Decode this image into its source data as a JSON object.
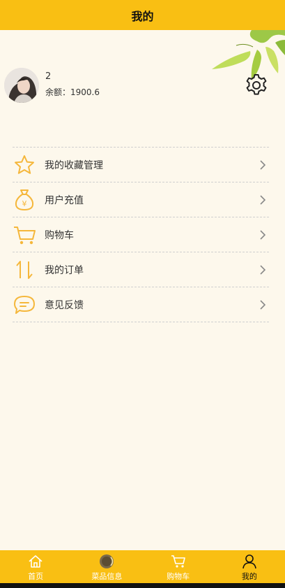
{
  "header": {
    "title": "我的"
  },
  "profile": {
    "name": "2",
    "balance": "余额：1900.6"
  },
  "menu": [
    {
      "label": "我的收藏管理",
      "icon": "star-icon"
    },
    {
      "label": "用户充值",
      "icon": "money-bag-icon"
    },
    {
      "label": "购物车",
      "icon": "cart-icon"
    },
    {
      "label": "我的订单",
      "icon": "sort-arrows-icon"
    },
    {
      "label": "意见反馈",
      "icon": "chat-bubble-icon"
    }
  ],
  "tabbar": [
    {
      "label": "首页",
      "icon": "home-icon"
    },
    {
      "label": "菜品信息",
      "icon": "dish-icon"
    },
    {
      "label": "购物车",
      "icon": "cart-icon"
    },
    {
      "label": "我的",
      "icon": "user-icon",
      "active": true
    }
  ],
  "colors": {
    "accent": "#f9bf13",
    "background": "#fdf8ec",
    "icon": "#f5b73b"
  }
}
